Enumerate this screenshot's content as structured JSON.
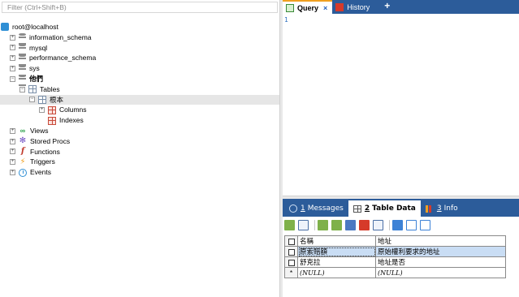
{
  "left_panel": {
    "filter_placeholder": "Filter (Ctrl+Shift+B)",
    "tree": {
      "root": "root@localhost",
      "databases": [
        "information_schema",
        "mysql",
        "performance_schema",
        "sys",
        "他們"
      ],
      "tables_label": "Tables",
      "table_name": "根本",
      "columns_label": "Columns",
      "indexes_label": "Indexes",
      "views_label": "Views",
      "stored_procs_label": "Stored Procs",
      "functions_label": "Functions",
      "triggers_label": "Triggers",
      "events_label": "Events",
      "expand_plus": "+",
      "expand_minus": "−"
    }
  },
  "editor": {
    "tabs": [
      {
        "label": "Query",
        "close": "×"
      },
      {
        "label": "History"
      }
    ],
    "new_tab": "+",
    "line_number": "1"
  },
  "results": {
    "tabs": [
      {
        "num": "1",
        "label": "Messages"
      },
      {
        "num": "2",
        "label": "Table Data"
      },
      {
        "num": "3",
        "label": "Info"
      }
    ],
    "columns": [
      "名稱",
      "地址"
    ],
    "rows": [
      [
        "原索賠額",
        "原始權利要求的地址"
      ],
      [
        "舒克拉",
        "地址是否"
      ]
    ],
    "new_row_marker": "*",
    "null_text": "(NULL)"
  },
  "colors": {
    "tab_bar": "#2c5c9a",
    "active_tab_accent": "#f0a020",
    "selected_row": "#c9ddf4"
  }
}
